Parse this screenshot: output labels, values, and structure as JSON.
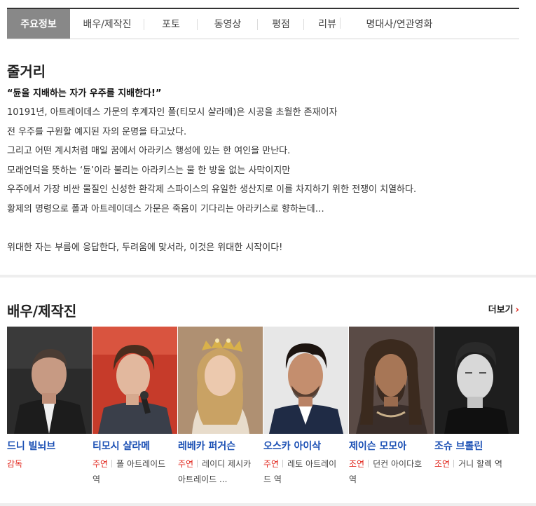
{
  "tabs": [
    {
      "label": "주요정보",
      "active": true
    },
    {
      "label": "배우/제작진",
      "active": false
    },
    {
      "label": "포토",
      "active": false
    },
    {
      "label": "동영상",
      "active": false
    },
    {
      "label": "평점",
      "active": false
    },
    {
      "label": "리뷰",
      "active": false
    },
    {
      "label": "명대사/연관영화",
      "active": false
    }
  ],
  "synopsis": {
    "title": "줄거리",
    "tagline": "“듄을 지배하는 자가 우주를 지배한다!”",
    "lines": [
      "10191년, 아트레이데스 가문의 후계자인 폴(티모시 샬라메)은 시공을 초월한 존재이자",
      " 전 우주를 구원할 예지된 자의 운명을 타고났다.",
      " 그리고 어떤 계시처럼 매일 꿈에서 아라키스 행성에 있는 한 여인을 만난다.",
      " 모래언덕을 뜻하는 ‘듄’이라 불리는 아라키스는 물 한 방울 없는 사막이지만",
      " 우주에서 가장 비싼 물질인 신성한 환각제 스파이스의 유일한 생산지로 이를 차지하기 위한 전쟁이 치열하다.",
      " 황제의 명령으로 폴과 아트레이데스 가문은 죽음이 기다리는 아라키스로 향하는데…"
    ],
    "closing": " 위대한 자는 부름에 응답한다, 두려움에 맞서라, 이것은 위대한 시작이다!"
  },
  "cast": {
    "title": "배우/제작진",
    "more_label": "더보기",
    "people": [
      {
        "name": "드니 빌뇌브",
        "role": "감독",
        "character": ""
      },
      {
        "name": "티모시 샬라메",
        "role": "주연",
        "character": "폴 아트레이드 역"
      },
      {
        "name": "레베카 퍼거슨",
        "role": "주연",
        "character": "레이디 제시카 아트레이드 ..."
      },
      {
        "name": "오스카 아이삭",
        "role": "주연",
        "character": "레토 아트레이드 역"
      },
      {
        "name": "제이슨 모모아",
        "role": "조연",
        "character": "던컨 아이다호 역"
      },
      {
        "name": "조슈 브롤린",
        "role": "조연",
        "character": "거니 할렉 역"
      }
    ]
  },
  "colors": {
    "accent": "#e1261c",
    "link": "#1a4fb4",
    "active_tab": "#888888"
  }
}
